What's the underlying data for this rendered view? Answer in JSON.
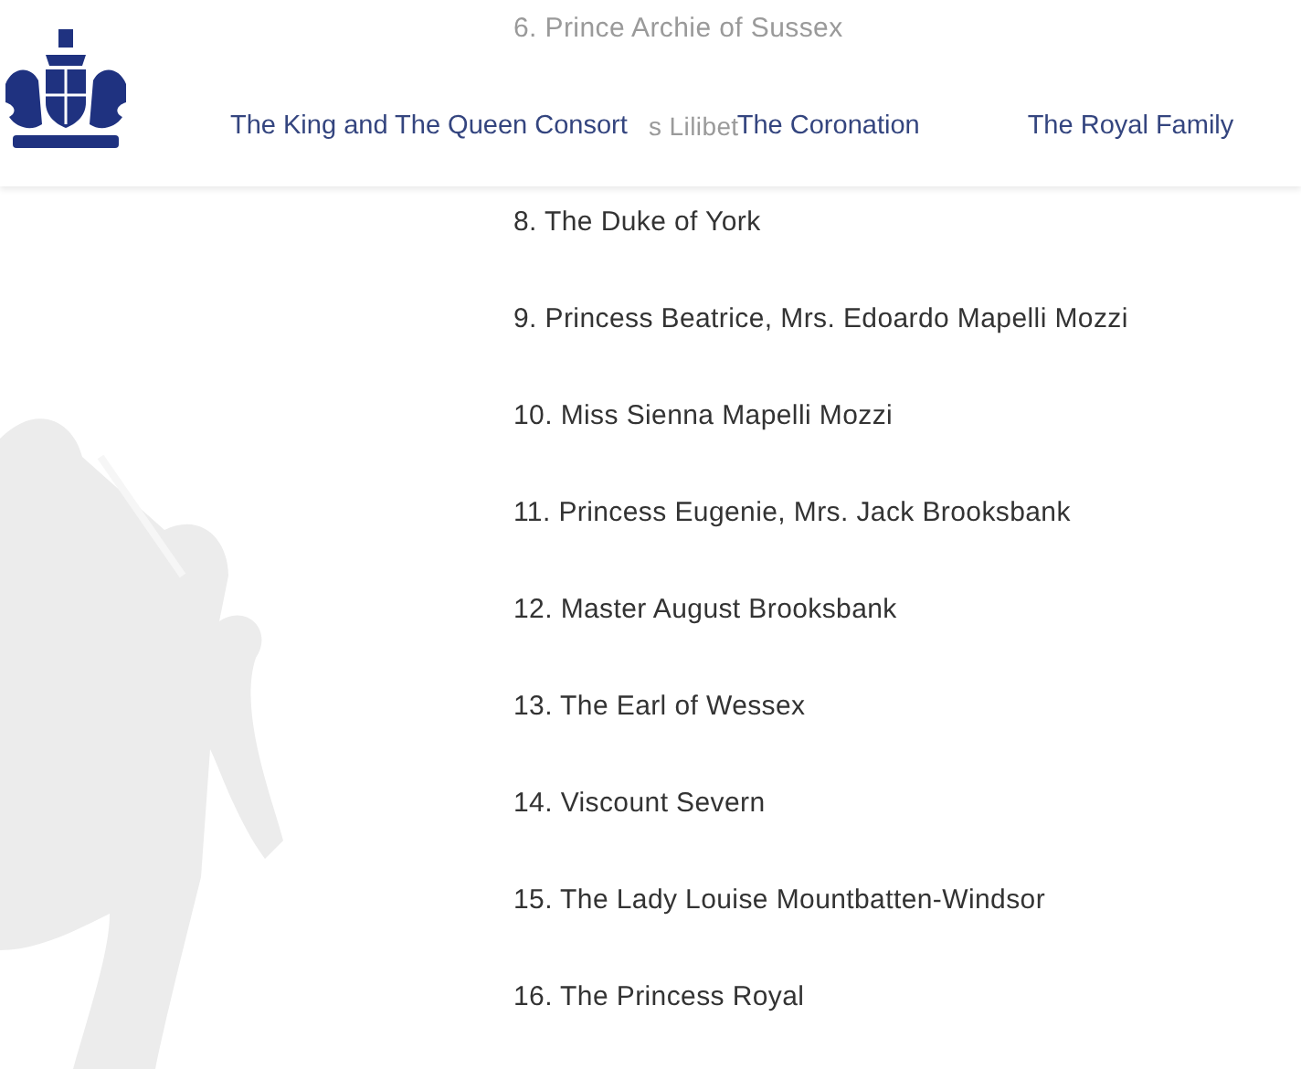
{
  "header": {
    "nav": [
      {
        "label": "The King and The Queen Consort"
      },
      {
        "label": "The Coronation"
      },
      {
        "label": "The Royal Family"
      }
    ]
  },
  "succession": [
    {
      "text": "6. Prince Archie of Sussex",
      "kind": "faded"
    },
    {
      "text": "s Lilibet",
      "kind": "covered"
    },
    {
      "text": "8. The Duke of York",
      "kind": "full"
    },
    {
      "text": "9. Princess Beatrice, Mrs. Edoardo Mapelli Mozzi",
      "kind": "full"
    },
    {
      "text": "10. Miss Sienna Mapelli Mozzi",
      "kind": "full"
    },
    {
      "text": "11. Princess Eugenie, Mrs. Jack Brooksbank",
      "kind": "full"
    },
    {
      "text": "12. Master August Brooksbank",
      "kind": "full"
    },
    {
      "text": "13. The Earl of Wessex",
      "kind": "full"
    },
    {
      "text": "14. Viscount Severn",
      "kind": "full"
    },
    {
      "text": "15. The Lady Louise Mountbatten-Windsor",
      "kind": "full"
    },
    {
      "text": "16. The Princess Royal",
      "kind": "full"
    }
  ]
}
